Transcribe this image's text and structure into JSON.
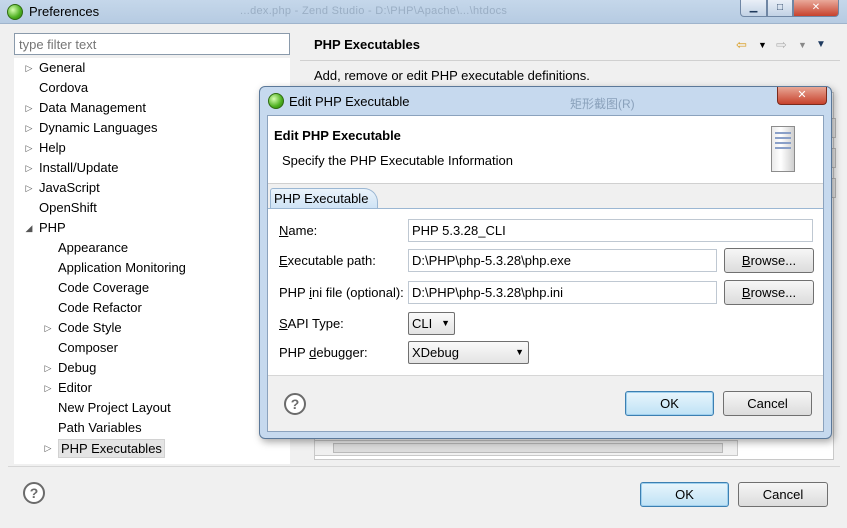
{
  "window": {
    "title": "Preferences",
    "background_title_fragment": "...dex.php - Zend Studio - D:\\PHP\\Apache\\...\\htdocs"
  },
  "filter": {
    "placeholder": "type filter text"
  },
  "tree": {
    "items": [
      {
        "label": "General",
        "level": 0,
        "arrow": "collapsed"
      },
      {
        "label": "Cordova",
        "level": 0,
        "arrow": "none"
      },
      {
        "label": "Data Management",
        "level": 0,
        "arrow": "collapsed"
      },
      {
        "label": "Dynamic Languages",
        "level": 0,
        "arrow": "collapsed"
      },
      {
        "label": "Help",
        "level": 0,
        "arrow": "collapsed"
      },
      {
        "label": "Install/Update",
        "level": 0,
        "arrow": "collapsed"
      },
      {
        "label": "JavaScript",
        "level": 0,
        "arrow": "collapsed"
      },
      {
        "label": "OpenShift",
        "level": 0,
        "arrow": "none"
      },
      {
        "label": "PHP",
        "level": 0,
        "arrow": "expanded"
      },
      {
        "label": "Appearance",
        "level": 1,
        "arrow": "none"
      },
      {
        "label": "Application Monitoring",
        "level": 1,
        "arrow": "none"
      },
      {
        "label": "Code Coverage",
        "level": 1,
        "arrow": "none"
      },
      {
        "label": "Code Refactor",
        "level": 1,
        "arrow": "none"
      },
      {
        "label": "Code Style",
        "level": 1,
        "arrow": "collapsed"
      },
      {
        "label": "Composer",
        "level": 1,
        "arrow": "none"
      },
      {
        "label": "Debug",
        "level": 1,
        "arrow": "collapsed"
      },
      {
        "label": "Editor",
        "level": 1,
        "arrow": "collapsed"
      },
      {
        "label": "New Project Layout",
        "level": 1,
        "arrow": "none"
      },
      {
        "label": "Path Variables",
        "level": 1,
        "arrow": "none"
      },
      {
        "label": "PHP Executables",
        "level": 1,
        "arrow": "collapsed",
        "selected": true
      }
    ]
  },
  "page": {
    "title": "PHP Executables",
    "description": "Add, remove or edit PHP executable definitions."
  },
  "footer": {
    "ok": "OK",
    "cancel": "Cancel"
  },
  "dialog": {
    "title": "Edit PHP Executable",
    "ghost_text": "矩形截图(R)",
    "header_title": "Edit PHP Executable",
    "header_subtitle": "Specify the PHP Executable Information",
    "tab": "PHP Executable",
    "fields": {
      "name_label_mnemonic": "N",
      "name_label_rest": "ame:",
      "name_value": "PHP 5.3.28_CLI",
      "path_label_mnemonic": "E",
      "path_label_rest": "xecutable path:",
      "path_value": "D:\\PHP\\php-5.3.28\\php.exe",
      "ini_label_pre": "PHP ",
      "ini_label_mnemonic": "i",
      "ini_label_rest": "ni file (optional):",
      "ini_value": "D:\\PHP\\php-5.3.28\\php.ini",
      "sapi_label_mnemonic": "S",
      "sapi_label_rest": "API Type:",
      "sapi_value": "CLI",
      "debugger_label_pre": "PHP ",
      "debugger_label_mnemonic": "d",
      "debugger_label_rest": "ebugger:",
      "debugger_value": "XDebug"
    },
    "browse_mnemonic": "B",
    "browse_rest": "rowse...",
    "ok": "OK",
    "cancel": "Cancel"
  }
}
